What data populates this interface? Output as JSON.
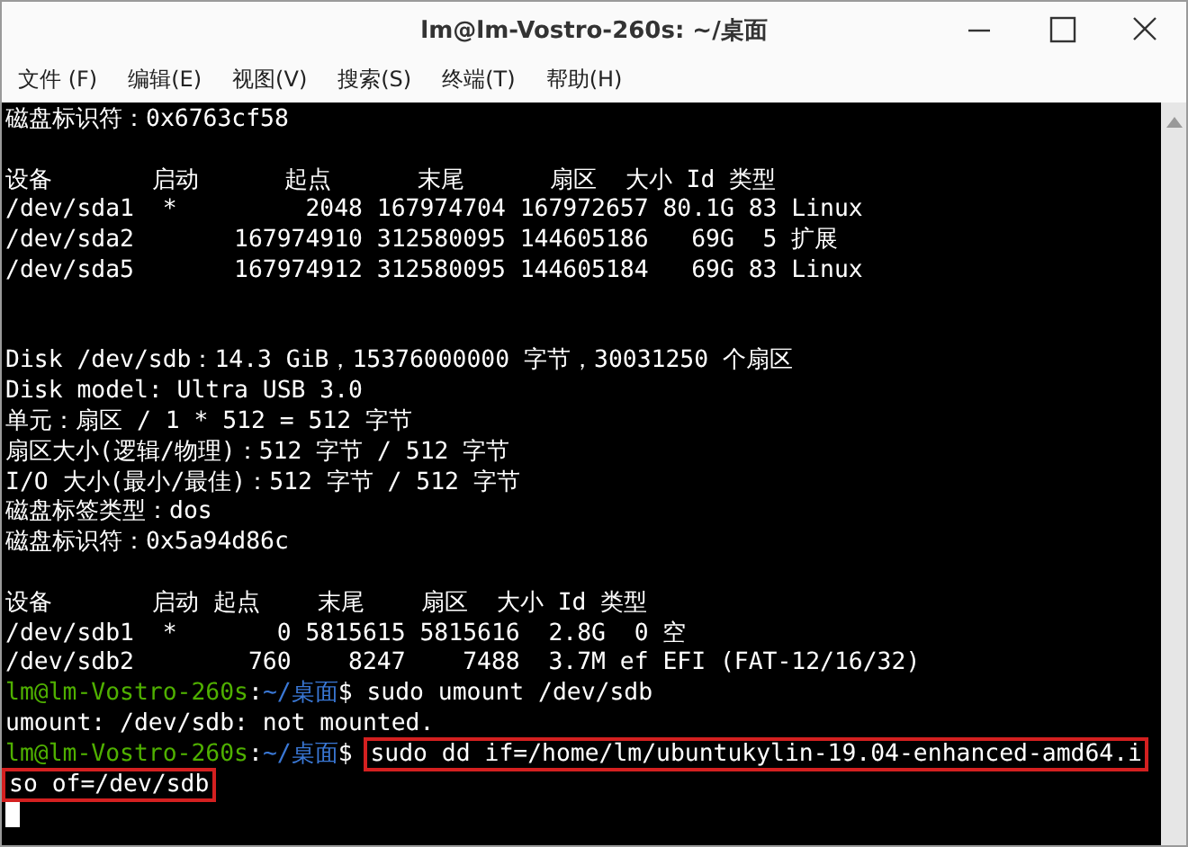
{
  "window": {
    "title": "lm@lm-Vostro-260s: ~/桌面"
  },
  "menu": [
    "文件 (F)",
    "编辑(E)",
    "视图(V)",
    "搜索(S)",
    "终端(T)",
    "帮助(H)"
  ],
  "terminal": {
    "lines": [
      {
        "kind": "output",
        "text": "磁盘标识符：0x6763cf58",
        "highlighted": false
      },
      {
        "kind": "blank"
      },
      {
        "kind": "output",
        "text": "设备       启动      起点      末尾      扇区  大小 Id 类型",
        "highlighted": false
      },
      {
        "kind": "output",
        "text": "/dev/sda1  *         2048 167974704 167972657 80.1G 83 Linux",
        "highlighted": false
      },
      {
        "kind": "output",
        "text": "/dev/sda2       167974910 312580095 144605186   69G  5 扩展",
        "highlighted": false
      },
      {
        "kind": "output",
        "text": "/dev/sda5       167974912 312580095 144605184   69G 83 Linux",
        "highlighted": false
      },
      {
        "kind": "blank"
      },
      {
        "kind": "blank"
      },
      {
        "kind": "output",
        "text": "Disk /dev/sdb：14.3 GiB，15376000000 字节，30031250 个扇区",
        "highlighted": false
      },
      {
        "kind": "output",
        "text": "Disk model: Ultra USB 3.0",
        "highlighted": false
      },
      {
        "kind": "output",
        "text": "单元：扇区 / 1 * 512 = 512 字节",
        "highlighted": false
      },
      {
        "kind": "output",
        "text": "扇区大小(逻辑/物理)：512 字节 / 512 字节",
        "highlighted": false
      },
      {
        "kind": "output",
        "text": "I/O 大小(最小/最佳)：512 字节 / 512 字节",
        "highlighted": false
      },
      {
        "kind": "output",
        "text": "磁盘标签类型：dos",
        "highlighted": false
      },
      {
        "kind": "output",
        "text": "磁盘标识符：0x5a94d86c",
        "highlighted": false
      },
      {
        "kind": "blank"
      },
      {
        "kind": "output",
        "text": "设备       启动 起点    末尾    扇区  大小 Id 类型",
        "highlighted": false
      },
      {
        "kind": "output",
        "text": "/dev/sdb1  *       0 5815615 5815616  2.8G  0 空",
        "highlighted": false
      },
      {
        "kind": "output",
        "text": "/dev/sdb2        760    8247    7488  3.7M ef EFI (FAT-12/16/32)",
        "highlighted": false
      },
      {
        "kind": "prompt",
        "user": "lm@lm-Vostro-260s",
        "sep": ":",
        "path": "~/桌面",
        "symbol": "$",
        "command": "sudo umount /dev/sdb",
        "highlighted": false
      },
      {
        "kind": "output",
        "text": "umount: /dev/sdb: not mounted.",
        "highlighted": false
      },
      {
        "kind": "prompt",
        "user": "lm@lm-Vostro-260s",
        "sep": ":",
        "path": "~/桌面",
        "symbol": "$",
        "command": "sudo dd if=/home/lm/ubuntukylin-19.04-enhanced-amd64.i",
        "highlighted": true
      },
      {
        "kind": "output",
        "text": "so of=/dev/sdb",
        "highlighted": true
      },
      {
        "kind": "cursor"
      }
    ]
  }
}
